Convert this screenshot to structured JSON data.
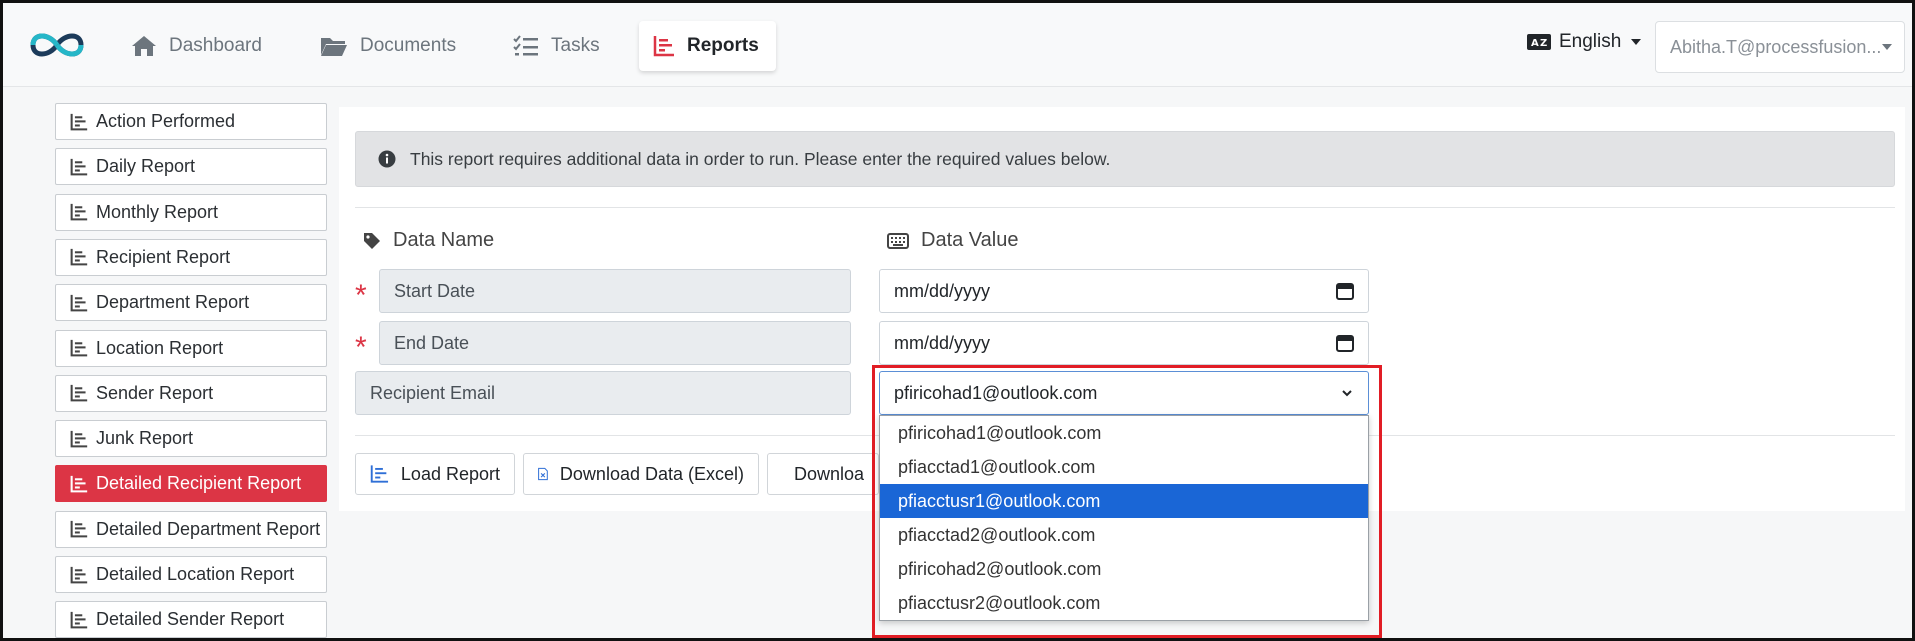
{
  "colors": {
    "accent": "#dc3545",
    "selected": "#1a66d6",
    "highlight": "#e11d25"
  },
  "navbar": {
    "logo_icon": "infinity-logo-icon",
    "items": [
      {
        "label": "Dashboard",
        "icon": "home-icon"
      },
      {
        "label": "Documents",
        "icon": "folder-icon"
      },
      {
        "label": "Tasks",
        "icon": "tasks-icon"
      },
      {
        "label": "Reports",
        "icon": "chart-icon",
        "active": true
      }
    ],
    "language": "English",
    "user": "Abitha.T@processfusion..."
  },
  "sidebar": {
    "items": [
      {
        "label": "Action Performed"
      },
      {
        "label": "Daily Report"
      },
      {
        "label": "Monthly Report"
      },
      {
        "label": "Recipient Report"
      },
      {
        "label": "Department Report"
      },
      {
        "label": "Location Report"
      },
      {
        "label": "Sender Report"
      },
      {
        "label": "Junk Report"
      },
      {
        "label": "Detailed Recipient Report",
        "active": true
      },
      {
        "label": "Detailed Department Report"
      },
      {
        "label": "Detailed Location Report"
      },
      {
        "label": "Detailed Sender Report"
      }
    ]
  },
  "main": {
    "alert": "This report requires additional data in order to run. Please enter the required values below.",
    "headers": {
      "name": "Data Name",
      "value": "Data Value"
    },
    "fields": [
      {
        "name": "Start Date",
        "required": true,
        "value": "mm/dd/yyyy"
      },
      {
        "name": "End Date",
        "required": true,
        "value": "mm/dd/yyyy"
      },
      {
        "name": "Recipient Email",
        "required": false,
        "value": "pfiricohad1@outlook.com"
      }
    ],
    "buttons": [
      {
        "label": "Load Report"
      },
      {
        "label": "Download Data (Excel)"
      },
      {
        "label": "Downloa"
      }
    ],
    "dropdown_options": [
      "pfiricohad1@outlook.com",
      "pfiacctad1@outlook.com",
      "pfiacctusr1@outlook.com",
      "pfiacctad2@outlook.com",
      "pfiricohad2@outlook.com",
      "pfiacctusr2@outlook.com"
    ],
    "selected_option": "pfiacctusr1@outlook.com"
  }
}
